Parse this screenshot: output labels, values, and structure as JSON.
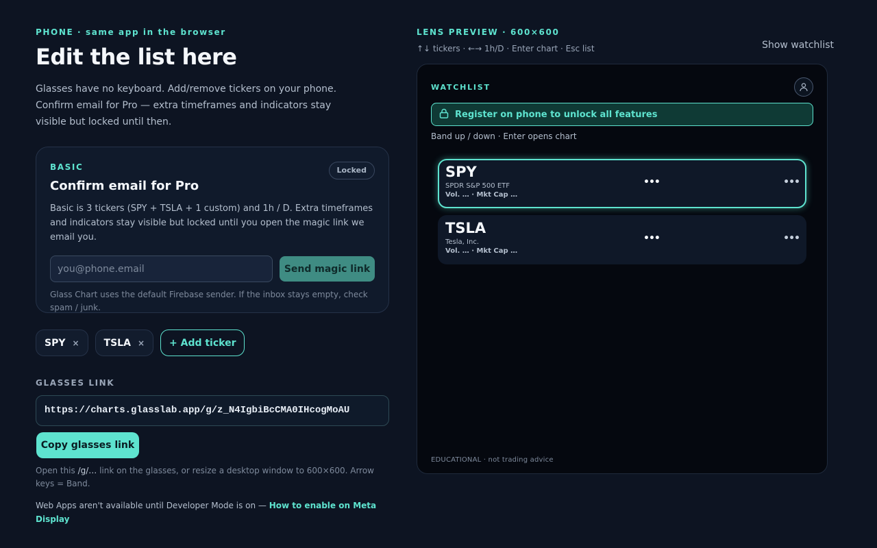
{
  "phone": {
    "eyebrow": "PHONE · same app in the browser",
    "title": "Edit the list here",
    "intro": "Glasses have no keyboard. Add/remove tickers on your phone. Confirm email for Pro — extra timeframes and indicators stay visible but locked until then."
  },
  "tier_card": {
    "tier": "BASIC",
    "locked_badge": "Locked",
    "heading": "Confirm email for Pro",
    "description": "Basic is 3 tickers (SPY + TSLA + 1 custom) and 1h / D. Extra timeframes and indicators stay visible but locked until you open the magic link we email you.",
    "email_placeholder": "you@phone.email",
    "email_value": "",
    "send_label": "Send magic link",
    "note": "Glass Chart uses the default Firebase sender. If the inbox stays empty, check spam / junk."
  },
  "tickers": [
    {
      "symbol": "SPY",
      "remove": "×"
    },
    {
      "symbol": "TSLA",
      "remove": "×"
    }
  ],
  "add_ticker_label": "+ Add ticker",
  "glasses_link": {
    "label": "GLASSES LINK",
    "url": "https://charts.glasslab.app/g/z_N4IgbiBcCMA0IHcogMoAU",
    "copy_label": "Copy glasses link",
    "help_prefix": "Open this ",
    "help_code": "/g/…",
    "help_suffix": " link on the glasses, or resize a desktop window to 600×600. Arrow keys = Band.",
    "devmode_text": "Web Apps aren't available until Developer Mode is on — ",
    "devmode_link": "How to enable on Meta Display"
  },
  "lens": {
    "eyebrow": "LENS PREVIEW · 600×600",
    "hint": "↑↓ tickers · ←→ 1h/D · Enter chart · Esc list",
    "show_watchlist": "Show watchlist",
    "watchlist_title": "WATCHLIST",
    "register_banner": "Register on phone to unlock all features",
    "band_hint": "Band up / down · Enter opens chart",
    "rows": [
      {
        "ticker": "SPY",
        "name": "SPDR S&P 500 ETF",
        "meta": "Vol. … · Mkt Cap …",
        "mid": "•••",
        "right": "•••",
        "selected": true
      },
      {
        "ticker": "TSLA",
        "name": "Tesla, Inc.",
        "meta": "Vol. … · Mkt Cap …",
        "mid": "•••",
        "right": "•••",
        "selected": false
      }
    ],
    "footer": "EDUCATIONAL · not trading advice"
  },
  "colors": {
    "accent": "#5ee3cf",
    "background": "#0d1422",
    "lens_background": "#05080f"
  },
  "icons": {
    "lock": "lock-icon",
    "avatar": "user-icon",
    "remove": "close-icon"
  }
}
